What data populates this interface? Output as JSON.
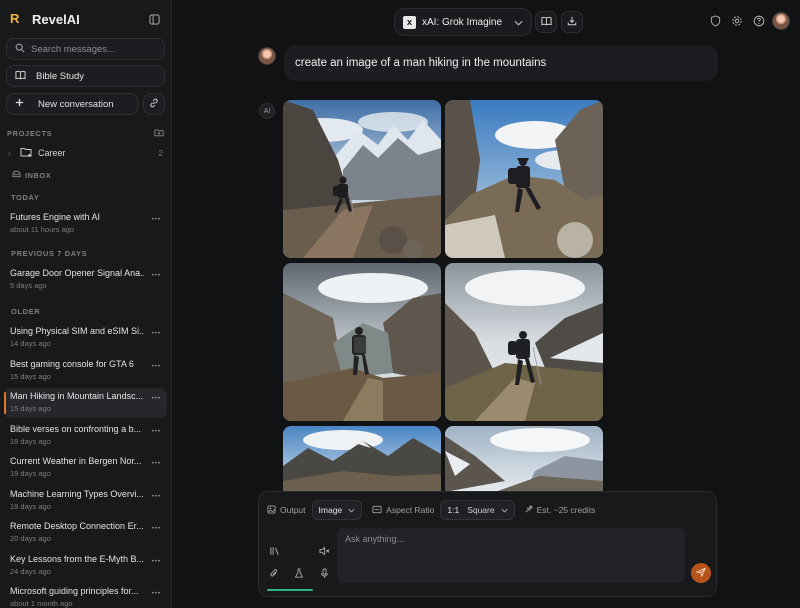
{
  "app": {
    "name": "RevelAI"
  },
  "sidebar": {
    "search_placeholder": "Search messages...",
    "pinned": "Bible Study",
    "new_conversation": "New conversation",
    "projects_label": "PROJECTS",
    "projects": [
      {
        "name": "Career",
        "count": "2"
      }
    ],
    "inbox_label": "INBOX",
    "groups": [
      {
        "label": "TODAY",
        "items": [
          {
            "title": "Futures Engine with AI",
            "time": "about 11 hours ago"
          }
        ]
      },
      {
        "label": "PREVIOUS 7 DAYS",
        "items": [
          {
            "title": "Garage Door Opener Signal Ana...",
            "time": "5 days ago"
          }
        ]
      },
      {
        "label": "OLDER",
        "items": [
          {
            "title": "Using Physical SIM and eSIM Si...",
            "time": "14 days ago"
          },
          {
            "title": "Best gaming console for GTA 6",
            "time": "15 days ago"
          },
          {
            "title": "Man Hiking in Mountain Landsc...",
            "time": "15 days ago",
            "active": true
          },
          {
            "title": "Bible verses on confronting a b...",
            "time": "18 days ago"
          },
          {
            "title": "Current Weather in Bergen Nor...",
            "time": "19 days ago"
          },
          {
            "title": "Machine Learning Types Overvi...",
            "time": "19 days ago"
          },
          {
            "title": "Remote Desktop Connection Er...",
            "time": "20 days ago"
          },
          {
            "title": "Key Lessons from the E-Myth B...",
            "time": "24 days ago"
          },
          {
            "title": "Microsoft guiding principles for...",
            "time": "about 1 month ago"
          }
        ]
      }
    ]
  },
  "header": {
    "model_name": "xAI: Grok Imagine",
    "model_icon_text": "x"
  },
  "chat": {
    "user_message": "create an image of a man hiking in the mountains",
    "ai_badge": "AI",
    "images": [
      "hiker-ridge-peaks",
      "hiker-rocky-path",
      "hiker-canyon-valley",
      "hiker-grassy-slope",
      "snowy-mountain-left",
      "snowy-mountain-right"
    ]
  },
  "composer": {
    "output_label": "Output",
    "output_value": "Image",
    "aspect_label": "Aspect Ratio",
    "aspect_value": "1:1",
    "aspect_name": "Square",
    "credits": "Est. ~25 credits",
    "placeholder": "Ask anything..."
  },
  "colors": {
    "accent": "#e07a2a",
    "brand": "#f2b233",
    "send": "#b5531a",
    "underline": "#2fb58a"
  }
}
